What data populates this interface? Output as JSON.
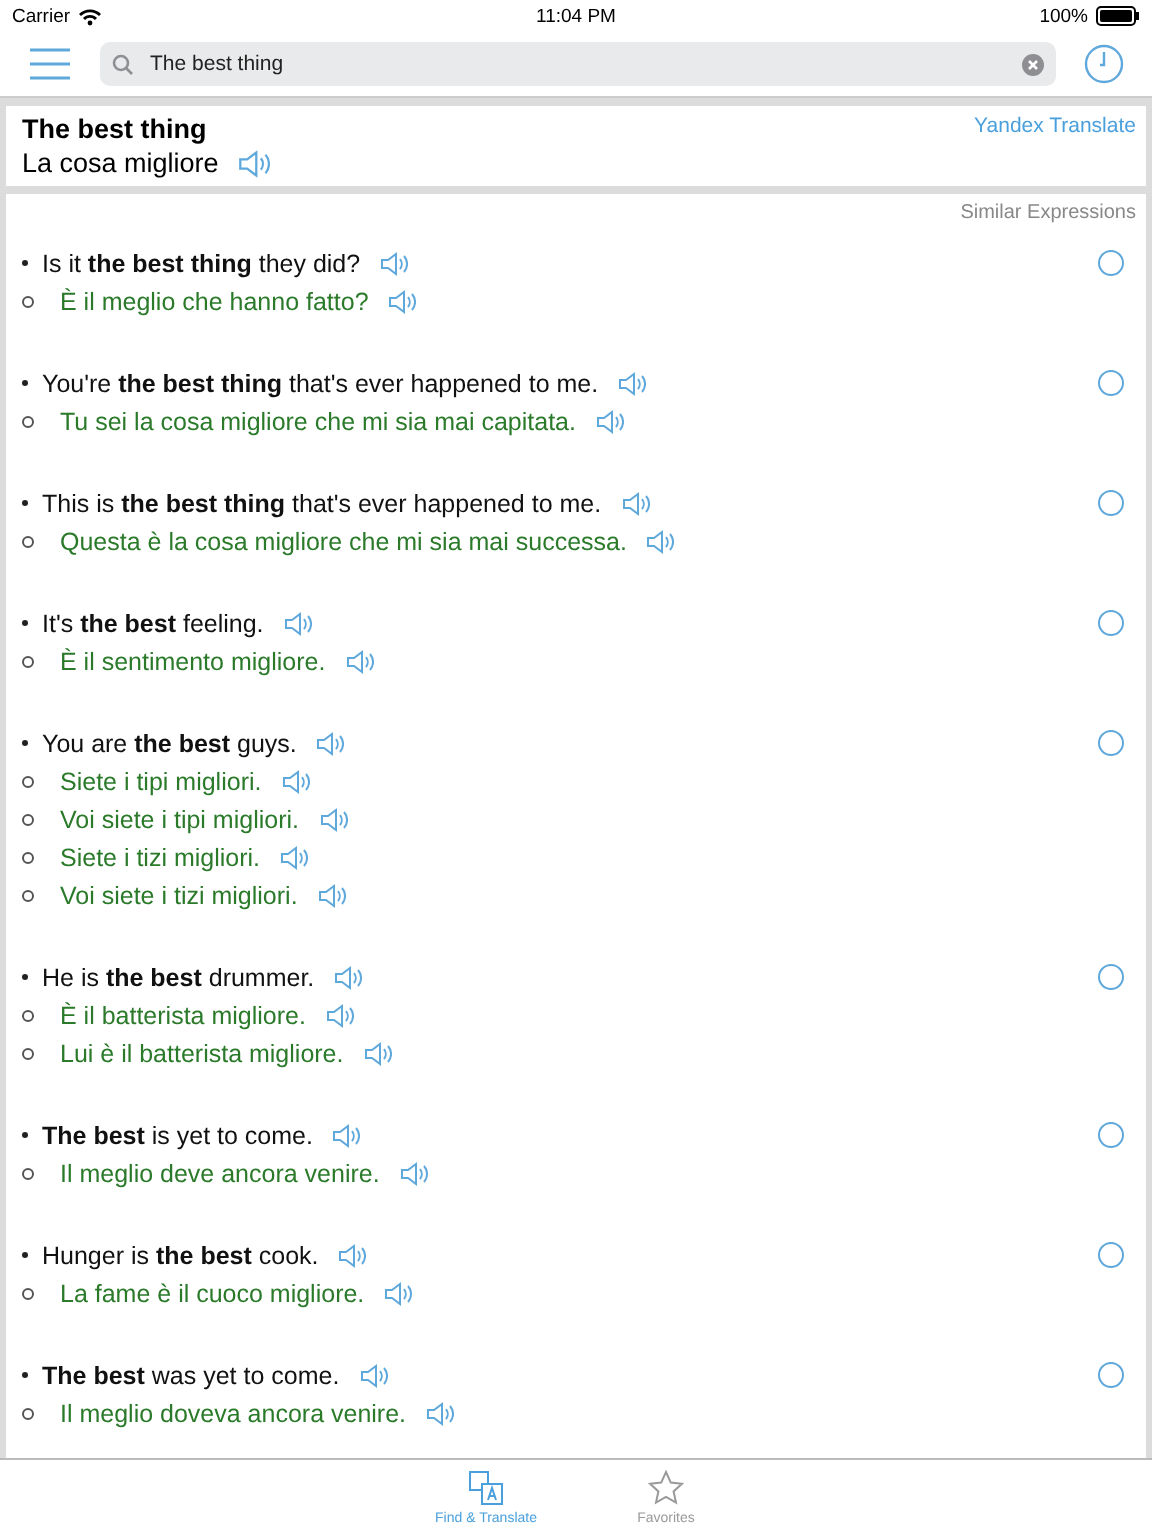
{
  "status_bar": {
    "carrier": "Carrier",
    "time": "11:04 PM",
    "battery": "100%"
  },
  "search": {
    "value": "The best thing"
  },
  "translation": {
    "source": "The best thing",
    "target": "La cosa migliore",
    "provider": "Yandex Translate"
  },
  "similar": {
    "heading": "Similar Expressions",
    "items": [
      {
        "phrase": "Is it **the best thing** they did?",
        "selected": false,
        "translations": [
          "È il meglio che hanno fatto?"
        ]
      },
      {
        "phrase": "You're **the best thing** that's ever happened to me.",
        "selected": false,
        "translations": [
          "Tu sei la cosa migliore che mi sia mai capitata."
        ]
      },
      {
        "phrase": "This is **the best thing** that's ever happened to me.",
        "selected": false,
        "translations": [
          "Questa è la cosa migliore che mi sia mai successa."
        ]
      },
      {
        "phrase": "It's **the best** feeling.",
        "selected": false,
        "translations": [
          "È il sentimento migliore."
        ]
      },
      {
        "phrase": "You are **the best** guys.",
        "selected": false,
        "translations": [
          "Siete i tipi migliori.",
          "Voi siete i tipi migliori.",
          "Siete i tizi migliori.",
          "Voi siete i tizi migliori."
        ]
      },
      {
        "phrase": "He is **the best** drummer.",
        "selected": false,
        "translations": [
          "È il batterista migliore.",
          "Lui è il batterista migliore."
        ]
      },
      {
        "phrase": "**The best** is yet to come.",
        "selected": false,
        "translations": [
          "Il meglio deve ancora venire."
        ]
      },
      {
        "phrase": "Hunger is **the best** cook.",
        "selected": false,
        "translations": [
          "La fame è il cuoco migliore."
        ]
      },
      {
        "phrase": "**The best** was yet to come.",
        "selected": false,
        "translations": [
          "Il meglio doveva ancora venire."
        ]
      }
    ]
  },
  "tabs": [
    {
      "label": "Find & Translate",
      "selected": true,
      "kind": "translate"
    },
    {
      "label": "Favorites",
      "selected": false,
      "kind": "star"
    }
  ]
}
